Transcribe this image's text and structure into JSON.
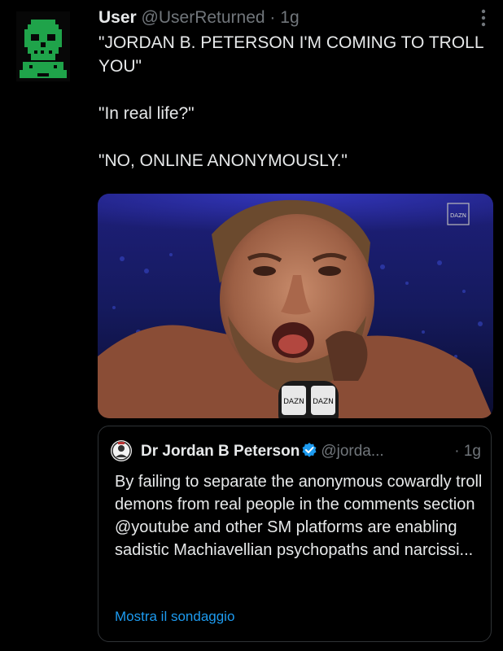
{
  "tweet": {
    "author_name": "User",
    "author_handle": "@UserReturned",
    "separator": " · ",
    "time": "1g",
    "lines": [
      "\"JORDAN B. PETERSON I'M COMING TO TROLL YOU\"",
      "\"In real life?\"",
      "\"NO, ONLINE ANONYMOUSLY.\""
    ],
    "media_watermark": "DAZN",
    "mic_label": "DAZN"
  },
  "quoted": {
    "author_name": "Dr Jordan B Peterson",
    "author_handle": "@jorda...",
    "separator": " · ",
    "time": "1g",
    "text": "By failing to separate the anonymous cowardly troll demons from real people in the comments section @youtube and other SM platforms are enabling sadistic Machiavellian psychopaths and narcissi...",
    "poll_link": "Mostra il sondaggio"
  },
  "colors": {
    "background": "#000000",
    "text": "#e7e9ea",
    "muted": "#71767b",
    "link": "#1d9bf0",
    "verified": "#1d9bf0",
    "border": "#2f3336",
    "avatar_accent": "#1fa34a"
  },
  "icons": {
    "avatar": "skull-avatar-icon",
    "more": "more-vertical-icon",
    "verified": "verified-badge-icon"
  }
}
